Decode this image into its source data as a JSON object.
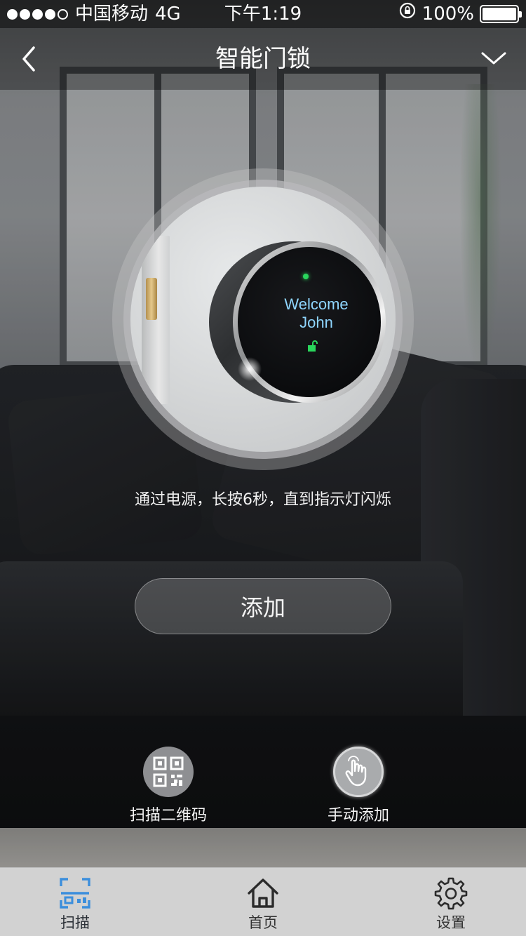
{
  "status_bar": {
    "signal_dots": 5,
    "signal_strength": 4,
    "carrier": "中国移动",
    "network": "4G",
    "time": "下午1:19",
    "battery": "100%"
  },
  "nav": {
    "title": "智能门锁",
    "back_icon": "chevron-left-icon",
    "more_icon": "chevron-down-icon"
  },
  "device_image": {
    "screen_text_line1": "Welcome",
    "screen_text_line2": "John"
  },
  "instruction": "通过电源，长按6秒，直到指示灯闪烁",
  "add_button": {
    "label": "添加"
  },
  "options": [
    {
      "label": "扫描二维码",
      "icon": "qr-code-icon"
    },
    {
      "label": "手动添加",
      "icon": "hand-pointer-icon"
    }
  ],
  "tabbar": {
    "items": [
      {
        "label": "扫描",
        "icon": "scan-icon",
        "color": "#3b8edc"
      },
      {
        "label": "首页",
        "icon": "home-icon"
      },
      {
        "label": "设置",
        "icon": "gear-icon"
      }
    ]
  },
  "colors": {
    "accent_blue": "#3b8edc",
    "led_green": "#29d65c",
    "screen_text": "#8fd6ff"
  }
}
